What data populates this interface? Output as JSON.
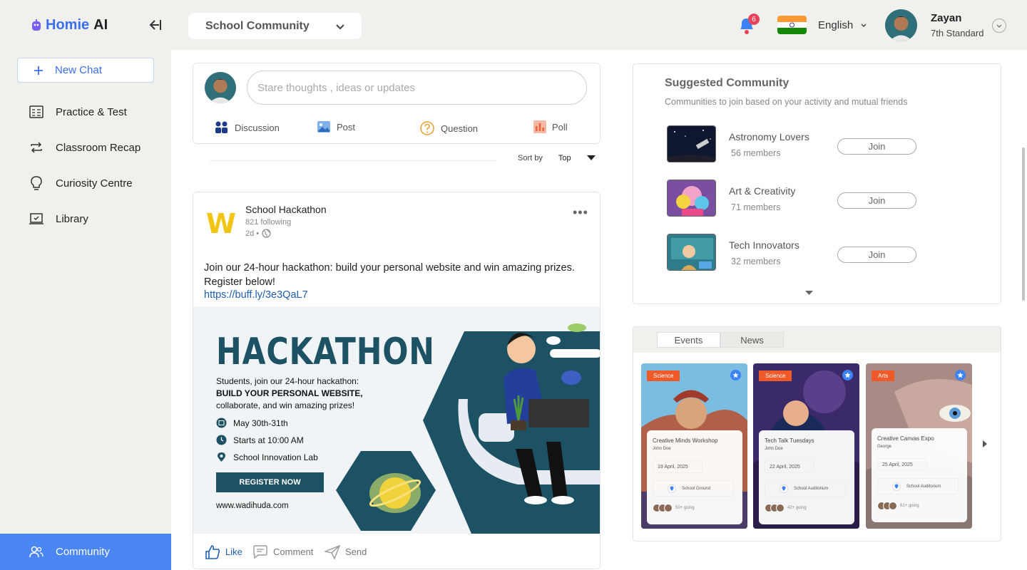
{
  "app": {
    "logo_part1": "Homie",
    "logo_part2": "AI"
  },
  "header": {
    "community_select": "School Community",
    "notification_count": "6",
    "language": "English",
    "user_name": "Zayan",
    "user_grade": "7th Standard"
  },
  "sidebar": {
    "new_chat": "New Chat",
    "items": [
      {
        "label": "Practice & Test",
        "icon": "test-sheet-icon"
      },
      {
        "label": "Classroom Recap",
        "icon": "repeat-arrows-icon"
      },
      {
        "label": "Curiosity Centre",
        "icon": "lightbulb-icon"
      },
      {
        "label": "Library",
        "icon": "laptop-check-icon"
      }
    ],
    "active": {
      "label": "Community",
      "icon": "people-icon"
    }
  },
  "composer": {
    "placeholder": "Stare thoughts , ideas or updates",
    "actions": [
      "Discussion",
      "Post",
      "Question",
      "Poll"
    ]
  },
  "sort": {
    "label": "Sort by",
    "value": "Top"
  },
  "post": {
    "author": "School Hackathon",
    "followers": "821 following",
    "time": "2d •",
    "text": "Join our 24-hour hackathon: build your personal website and win amazing prizes. Register below!",
    "link": "https://buff.ly/3e3QaL7",
    "banner": {
      "title": "HACKATHON",
      "line1": "Students, join our 24-hour hackathon:",
      "line2": "BUILD YOUR PERSONAL WEBSITE,",
      "line3": "collaborate, and win amazing prizes!",
      "date": "May 30th-31th",
      "time": "Starts at 10:00 AM",
      "place": "School Innovation Lab",
      "cta": "REGISTER NOW",
      "site": "www.wadihuda.com"
    },
    "actions": {
      "like": "Like",
      "comment": "Comment",
      "send": "Send"
    }
  },
  "suggested": {
    "title": "Suggested Community",
    "subtitle": "Communities to join based on your activity and mutual friends",
    "join_label": "Join",
    "items": [
      {
        "name": "Astronomy  Lovers",
        "members": "56 members"
      },
      {
        "name": "Art & Creativity",
        "members": "71 members"
      },
      {
        "name": "Tech Innovators",
        "members": "32 members"
      }
    ]
  },
  "events": {
    "tabs": [
      "Events",
      "News"
    ],
    "cards": [
      {
        "tag": "Science",
        "title": "Creative Minds Workshop",
        "organizer": "John Doe",
        "date": "19 April, 2025",
        "location": "School Ground",
        "going": "50+ going"
      },
      {
        "tag": "Science",
        "title": "Tech Talk Tuesdays",
        "organizer": "John Doe",
        "date": "22 April, 2025",
        "location": "School Auditorium",
        "going": "42+ going"
      },
      {
        "tag": "Arts",
        "title": "Creative Canvas Expo",
        "organizer": "George",
        "date": "25 April, 2025",
        "location": "School Auditorium",
        "going": "61+ going"
      }
    ]
  },
  "colors": {
    "accent": "#4a86f4",
    "brand_blue": "#3b6ef0",
    "banner_teal": "#1c5264",
    "tag_orange": "#f05a28"
  }
}
